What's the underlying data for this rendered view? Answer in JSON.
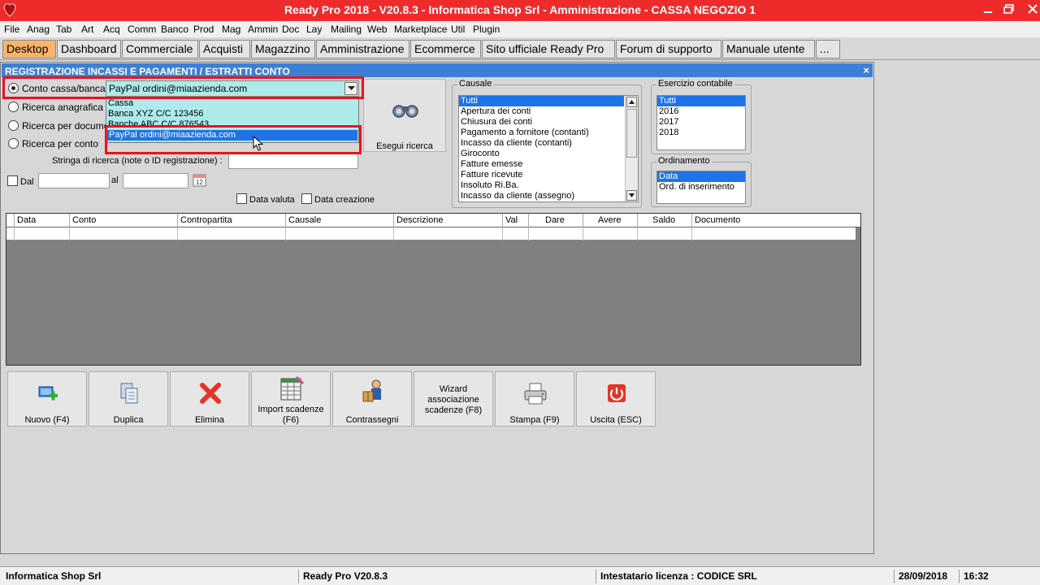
{
  "window": {
    "title": "Ready Pro 2018 - V20.8.3 - Informatica Shop Srl - Amministrazione - CASSA NEGOZIO 1",
    "controls": [
      "minimize-icon",
      "restore-icon",
      "close-icon"
    ]
  },
  "menu": [
    "File",
    "Anag",
    "Tab",
    "Art",
    "Acq",
    "Comm",
    "Banco",
    "Prod",
    "Mag",
    "Ammin",
    "Doc",
    "Lay",
    "Mailing",
    "Web",
    "Marketplace",
    "Util",
    "Plugin"
  ],
  "tabs": [
    "Desktop",
    "Dashboard",
    "Commerciale",
    "Acquisti",
    "Magazzino",
    "Amministrazione",
    "Ecommerce",
    "Sito ufficiale Ready Pro",
    "Forum di supporto",
    "Manuale utente",
    "..."
  ],
  "panel": {
    "title": "REGISTRAZIONE INCASSI E PAGAMENTI / ESTRATTI CONTO",
    "close": "×"
  },
  "search": {
    "options": [
      "Conto cassa/banca",
      "Ricerca anagrafica",
      "Ricerca per documen",
      "Ricerca per conto"
    ],
    "selected_option": 0,
    "account_value": "PayPal ordini@miaazienda.com",
    "dropdown_items": [
      "Cassa",
      "Banca XYZ C/C 123456",
      "Banche ABC C/C 876543",
      "PayPal ordini@miaazienda.com"
    ],
    "dropdown_selected": 3,
    "search_string_label": "Stringa di ricerca (note o ID registrazione) :",
    "search_string_value": "",
    "from_label": "Dal",
    "to_label": "al",
    "from_value": "",
    "to_value": "",
    "value_date_label": "Data valuta",
    "creation_date_label": "Data creazione",
    "search_button": "Esegui ricerca"
  },
  "causale": {
    "title": "Causale",
    "items": [
      "Tutti",
      "Apertura dei conti",
      "Chiusura dei conti",
      "Pagamento a fornitore (contanti)",
      "Incasso da cliente (contanti)",
      "Giroconto",
      "Fatture emesse",
      "Fatture ricevute",
      "Insoluto Ri.Ba.",
      "Incasso da cliente (assegno)"
    ],
    "selected": 0
  },
  "esercizio": {
    "title": "Esercizio contabile",
    "items": [
      "Tutti",
      "2016",
      "2017",
      "2018"
    ],
    "selected": 0
  },
  "ordinamento": {
    "title": "Ordinamento",
    "items": [
      "Data",
      "Ord. di inserimento"
    ],
    "selected": 0
  },
  "grid": {
    "columns": [
      "Data",
      "Conto",
      "Contropartita",
      "Causale",
      "Descrizione",
      "Val",
      "Dare",
      "Avere",
      "Saldo",
      "Documento"
    ]
  },
  "actions": [
    {
      "label": "Nuovo (F4)",
      "icon": "new-icon"
    },
    {
      "label": "Duplica",
      "icon": "duplicate-icon"
    },
    {
      "label": "Elimina",
      "icon": "delete-icon"
    },
    {
      "label": "Import scadenze\n(F6)",
      "icon": "import-icon"
    },
    {
      "label": "Contrassegni",
      "icon": "cash-on-delivery-icon"
    },
    {
      "label": "Wizard\nassociazione\nscadenze (F8)",
      "icon": ""
    },
    {
      "label": "Stampa (F9)",
      "icon": "printer-icon"
    },
    {
      "label": "Uscita (ESC)",
      "icon": "power-icon"
    }
  ],
  "status": {
    "company": "Informatica Shop Srl",
    "version": "Ready Pro V20.8.3",
    "license": "Intestatario licenza : CODICE SRL",
    "date": "28/09/2018",
    "time": "16:32"
  },
  "colors": {
    "titlebar": "#ee2b2b",
    "panel_header": "#3d7fd6",
    "active_tab": "#f7b46a",
    "combo_bg": "#aeeaea",
    "selection": "#1e73e6",
    "highlight_box": "#e8141b"
  }
}
